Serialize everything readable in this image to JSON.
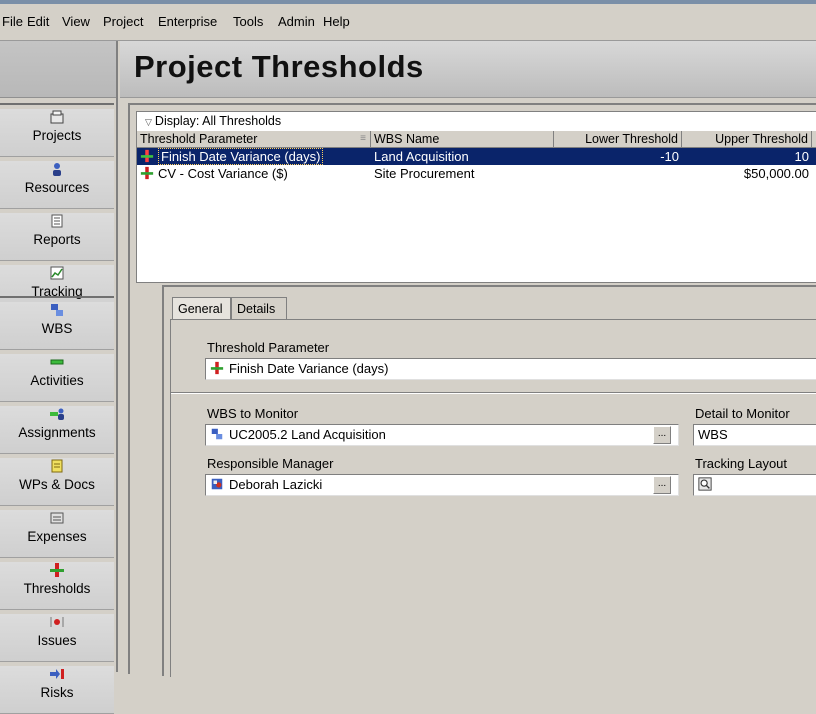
{
  "menu": {
    "items": [
      "File",
      "Edit",
      "View",
      "Project",
      "Enterprise",
      "Tools",
      "Admin",
      "Help"
    ]
  },
  "sidebar": {
    "items": [
      {
        "label": "Projects",
        "icon": "projects-icon"
      },
      {
        "label": "Resources",
        "icon": "resources-icon"
      },
      {
        "label": "Reports",
        "icon": "reports-icon"
      },
      {
        "label": "Tracking",
        "icon": "tracking-icon"
      },
      {
        "label": "WBS",
        "icon": "wbs-icon"
      },
      {
        "label": "Activities",
        "icon": "activities-icon"
      },
      {
        "label": "Assignments",
        "icon": "assignments-icon"
      },
      {
        "label": "WPs & Docs",
        "icon": "wps-docs-icon"
      },
      {
        "label": "Expenses",
        "icon": "expenses-icon"
      },
      {
        "label": "Thresholds",
        "icon": "thresholds-icon"
      },
      {
        "label": "Issues",
        "icon": "issues-icon"
      },
      {
        "label": "Risks",
        "icon": "risks-icon"
      }
    ]
  },
  "page": {
    "title": "Project Thresholds"
  },
  "grid": {
    "display_label": "Display: All Thresholds",
    "columns": [
      "Threshold Parameter",
      "WBS Name",
      "Lower Threshold",
      "Upper Threshold"
    ],
    "rows": [
      {
        "parameter": "Finish Date Variance (days)",
        "wbs": "Land Acquisition",
        "lower": "-10",
        "upper": "10",
        "selected": true
      },
      {
        "parameter": "CV - Cost Variance ($)",
        "wbs": "Site Procurement",
        "lower": "",
        "upper": "$50,000.00",
        "selected": false
      }
    ]
  },
  "detail": {
    "tabs": [
      "General",
      "Details"
    ],
    "active_tab": "General",
    "threshold_parameter_label": "Threshold Parameter",
    "threshold_parameter_value": "Finish Date Variance (days)",
    "wbs_to_monitor_label": "WBS to Monitor",
    "wbs_to_monitor_value": "UC2005.2  Land Acquisition",
    "detail_to_monitor_label": "Detail to Monitor",
    "detail_to_monitor_value": "WBS",
    "responsible_manager_label": "Responsible Manager",
    "responsible_manager_value": "Deborah Lazicki",
    "tracking_layout_label": "Tracking Layout",
    "tracking_layout_value": "",
    "ellipsis": "..."
  },
  "colors": {
    "selection": "#0a246a",
    "background": "#d4d0c8"
  }
}
